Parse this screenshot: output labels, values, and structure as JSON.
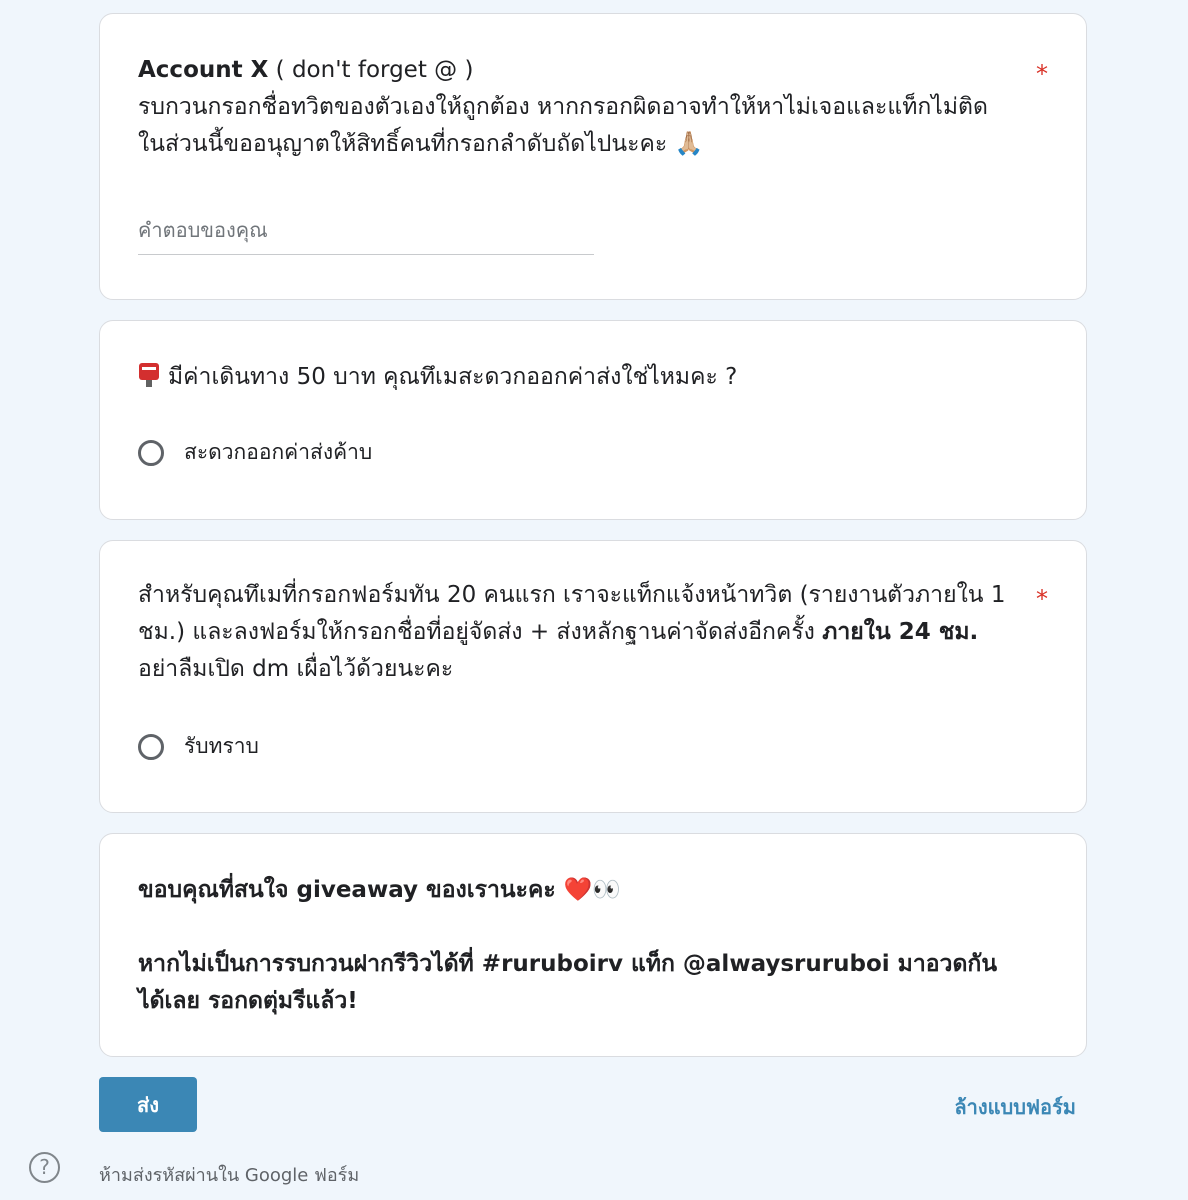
{
  "q1": {
    "title_bold": "Account X",
    "title_rest": " ( don't forget @ )",
    "desc_line1": "รบกวนกรอกชื่อทวิตของตัวเองให้ถูกต้อง หากกรอกผิดอาจทำให้หาไม่เจอและแท็กไม่ติด",
    "desc_line2": "ในส่วนนี้ขออนุญาตให้สิทธิ์คนที่กรอกลำดับถัดไปนะคะ",
    "desc_emoji": "🙏🏼",
    "required_mark": "*",
    "placeholder": "คำตอบของคุณ"
  },
  "q2": {
    "emoji_icon": "postbox-icon",
    "question": "มีค่าเดินทาง 50 บาท คุณทึเมสะดวกออกค่าส่งใช่ไหมคะ ?",
    "option": "สะดวกออกค่าส่งค้าบ"
  },
  "q3": {
    "text_part1": "สำหรับคุณทึเมที่กรอกฟอร์มทัน 20 คนแรก เราจะแท็กแจ้งหน้าทวิต (รายงานตัวภายใน 1 ชม.) และลงฟอร์มให้กรอกชื่อที่อยู่จัดส่ง + ส่งหลักฐานค่าจัดส่งอีกครั้ง ",
    "text_bold": "ภายใน 24 ชม.",
    "text_part2": " อย่าลืมเปิด dm เผื่อไว้ด้วยนะคะ",
    "required_mark": "*",
    "option": "รับทราบ"
  },
  "q4": {
    "line1": "ขอบคุณที่สนใจ giveaway ของเรานะคะ ❤️👀",
    "line2": "หากไม่เป็นการรบกวนฝากรีวิวได้ที่ #ruruboirv แท็ก @alwaysruruboi มาอวดกันได้เลย รอกดตุ่มรีแล้ว!"
  },
  "actions": {
    "submit_label": "ส่ง",
    "clear_label": "ล้างแบบฟอร์ม"
  },
  "footer": {
    "help_symbol": "?",
    "note": "ห้ามส่งรหัสผ่านใน Google ฟอร์ม"
  },
  "colors": {
    "background": "#f0f6fc",
    "accent": "#3b87b5",
    "required": "#d93025"
  }
}
